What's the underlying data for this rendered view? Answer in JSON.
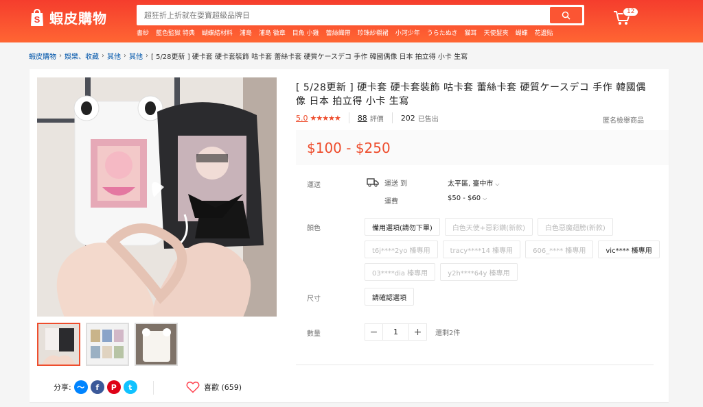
{
  "header": {
    "logo_text": "蝦皮購物",
    "search_placeholder": "超狂折上折就在耍寶超級品牌日",
    "hot_words": [
      "書紗",
      "藍色監獄 特典",
      "蝴蝶結材料",
      "浦島",
      "浦島 徽章",
      "目魚 小雞",
      "蕾絲織帶",
      "珍珠紗襯裙",
      "小河少年",
      "うらたぬき",
      "貓耳",
      "天使髮夾",
      "蝴蝶",
      "花邊貼"
    ],
    "cart_count": "12"
  },
  "breadcrumb": {
    "items": [
      "蝦皮購物",
      "娛樂、收藏",
      "其他",
      "其他"
    ],
    "current": "[ 5/28更新 ] 硬卡套 硬卡套裝飾 咕卡套 蕾絲卡套 硬質ケースデコ 手作 韓國偶像 日本 拍立得 小卡 生寫"
  },
  "product": {
    "title": "[ 5/28更新 ] 硬卡套 硬卡套裝飾 咕卡套 蕾絲卡套 硬質ケースデコ 手作 韓國偶像 日本 拍立得 小卡 生寫",
    "rating_score": "5.0",
    "stars": "★★★★★",
    "rating_count": "88",
    "rating_label": "評價",
    "sold_count": "202",
    "sold_label": "已售出",
    "report_label": "匿名檢舉商品",
    "price": "$100 - $250",
    "shipping_label": "運送",
    "ship_to_label": "運送 到",
    "ship_fee_label": "運費",
    "ship_to_value": "太平區, 臺中市",
    "ship_fee_value": "$50 - $60",
    "color_label": "顏色",
    "variations": [
      {
        "label": "備用選項(請勿下單)",
        "disabled": false
      },
      {
        "label": "白色天使+惡彩鑽(新款)",
        "disabled": true
      },
      {
        "label": "白色惡魔翅膀(新款)",
        "disabled": true
      },
      {
        "label": "t6j****2yo 榛專用",
        "disabled": true
      },
      {
        "label": "tracy****14 榛專用",
        "disabled": true
      },
      {
        "label": "606_**** 榛專用",
        "disabled": true
      },
      {
        "label": "vic**** 榛專用",
        "disabled": false
      },
      {
        "label": "03****dia 榛專用",
        "disabled": true
      },
      {
        "label": "y2h****64y 榛專用",
        "disabled": true
      }
    ],
    "size_label": "尺寸",
    "size_option": "請確認選項",
    "qty_label": "數量",
    "qty_value": "1",
    "stock_text": "還剩2件",
    "share_label": "分享:",
    "like_label": "喜歡 (659)"
  },
  "colors": {
    "accent": "#ee4d2d",
    "header": "#f53d2d"
  }
}
